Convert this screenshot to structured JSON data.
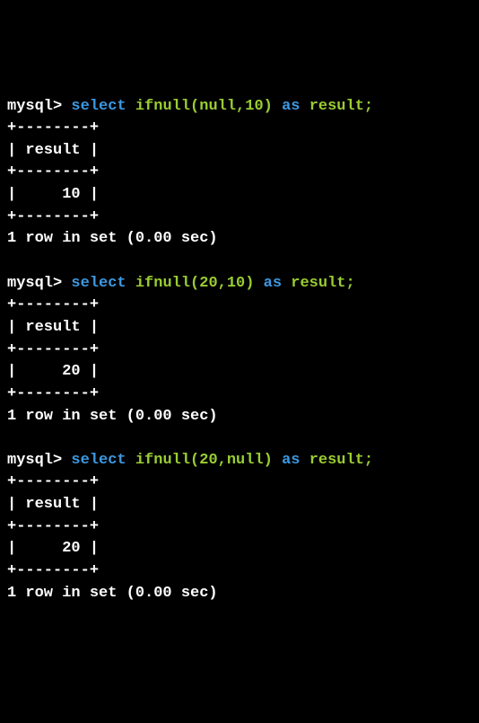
{
  "queries": [
    {
      "prompt": "mysql>",
      "query_parts": {
        "select": "select",
        "space1": " ",
        "func": "ifnull(null,10)",
        "space2": " ",
        "as": "as",
        "space3": " ",
        "alias": "result;"
      },
      "border": "+--------+",
      "header": "| result |",
      "row": "|     10 |",
      "footer": "1 row in set (0.00 sec)"
    },
    {
      "prompt": "mysql>",
      "query_parts": {
        "select": "select",
        "space1": " ",
        "func": "ifnull(20,10)",
        "space2": " ",
        "as": "as",
        "space3": " ",
        "alias": "result;"
      },
      "border": "+--------+",
      "header": "| result |",
      "row": "|     20 |",
      "footer": "1 row in set (0.00 sec)"
    },
    {
      "prompt": "mysql>",
      "query_parts": {
        "select": "select",
        "space1": " ",
        "func": "ifnull(20,null)",
        "space2": " ",
        "as": "as",
        "space3": " ",
        "alias": "result;"
      },
      "border": "+--------+",
      "header": "| result |",
      "row": "|     20 |",
      "footer": "1 row in set (0.00 sec)"
    }
  ]
}
